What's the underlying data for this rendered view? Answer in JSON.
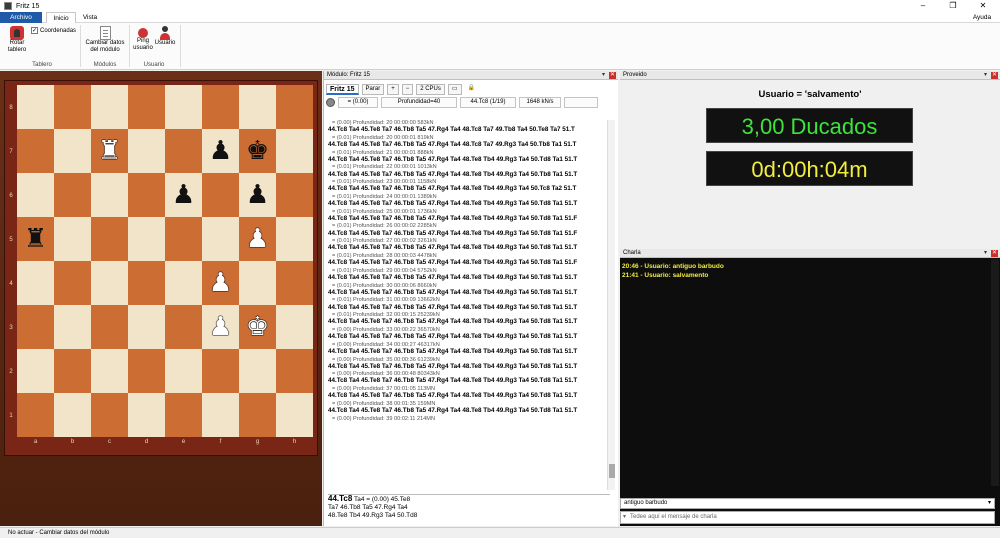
{
  "window": {
    "title": "Fritz 15",
    "minimize": "–",
    "maximize": "❐",
    "close": "✕"
  },
  "ribbon_tabs": {
    "archivo": "Archivo",
    "inicio": "Inicio",
    "vista": "Vista",
    "ayuda": "Ayuda"
  },
  "ribbon": {
    "rotar": "Rotar tablero",
    "coordenadas": "Coordenadas",
    "coordenadas_checked": "✓",
    "tablero_group": "Tablero",
    "cambiar_modulo": "Cambiar datos del módulo",
    "modulos_group": "Módulos",
    "ping": "Ping usuario",
    "usuario": "Usuario",
    "usuario_group": "Usuario"
  },
  "board": {
    "ranks": [
      "8",
      "7",
      "6",
      "5",
      "4",
      "3",
      "2",
      "1"
    ],
    "files": [
      "a",
      "b",
      "c",
      "d",
      "e",
      "f",
      "g",
      "h"
    ],
    "pieces": [
      {
        "square": "c7",
        "piece": "♜",
        "color": "white"
      },
      {
        "square": "f7",
        "piece": "♟",
        "color": "black"
      },
      {
        "square": "g7",
        "piece": "♚",
        "color": "black"
      },
      {
        "square": "e6",
        "piece": "♟",
        "color": "black"
      },
      {
        "square": "g6",
        "piece": "♟",
        "color": "black"
      },
      {
        "square": "a5",
        "piece": "♜",
        "color": "black"
      },
      {
        "square": "g5",
        "piece": "♟",
        "color": "white"
      },
      {
        "square": "f4",
        "piece": "♟",
        "color": "white"
      },
      {
        "square": "f3",
        "piece": "♟",
        "color": "white"
      },
      {
        "square": "g3",
        "piece": "♚",
        "color": "white"
      }
    ]
  },
  "engine": {
    "pane_title": "Módulo: Fritz 15",
    "engine_name": "Fritz 15",
    "stop": "Parar",
    "plus": "+",
    "minus": "−",
    "cpus": "2 CPUs",
    "eval": "= (0.00)",
    "depth": "Profundidad=40",
    "current_move": "44.Tc8 (1/19)",
    "speed": "1648 kN/s",
    "rows": [
      {
        "info": "= (0.00)   Profundidad: 20   00:00:00  583kN",
        "line": "44.Tc8 Ta4 45.Te8 Ta7 46.Tb8 Ta5 47.Rg4 Ta4 48.Tc8 Ta7 49.Tb8 Ta4 50.Te8 Ta7 51.T"
      },
      {
        "info": "= (0.01)   Profundidad: 20   00:00:01  819kN",
        "line": "44.Tc8 Ta4 45.Te8 Ta7 46.Tb8 Ta5 47.Rg4 Ta4 48.Tc8 Ta7 49.Rg3 Ta4 50.Tb8 Ta1 51.T"
      },
      {
        "info": "= (0.01)   Profundidad: 21   00:00:01  888kN",
        "line": "44.Tc8 Ta4 45.Te8 Ta7 46.Tb8 Ta5 47.Rg4 Ta4 48.Te8 Tb4 49.Rg3 Ta4 50.Td8 Ta1 51.T"
      },
      {
        "info": "= (0.01)   Profundidad: 22   00:00:01  1013kN",
        "line": "44.Tc8 Ta4 45.Te8 Ta7 46.Tb8 Ta5 47.Rg4 Ta4 48.Te8 Tb4 49.Rg3 Ta4 50.Tb8 Ta1 51.T"
      },
      {
        "info": "= (0.01)   Profundidad: 23   00:00:01  1158kN",
        "line": "44.Tc8 Ta4 45.Te8 Ta7 46.Tb8 Ta5 47.Rg4 Ta4 48.Te8 Tb4 49.Rg3 Ta4 50.Tc8 Ta2 51.T"
      },
      {
        "info": "= (0.01)   Profundidad: 24   00:00:01  1389kN",
        "line": "44.Tc8 Ta4 45.Te8 Ta7 46.Tb8 Ta5 47.Rg4 Ta4 48.Te8 Tb4 49.Rg3 Ta4 50.Td8 Ta1 51.T"
      },
      {
        "info": "= (0.01)   Profundidad: 25   00:00:01  1736kN",
        "line": "44.Tc8 Ta4 45.Te8 Ta7 46.Tb8 Ta5 47.Rg4 Ta4 48.Te8 Tb4 49.Rg3 Ta4 50.Td8 Ta1 51.F"
      },
      {
        "info": "= (0.01)   Profundidad: 26   00:00:02  2285kN",
        "line": "44.Tc8 Ta4 45.Te8 Ta7 46.Tb8 Ta5 47.Rg4 Ta4 48.Te8 Tb4 49.Rg3 Ta4 50.Td8 Ta1 51.F"
      },
      {
        "info": "= (0.01)   Profundidad: 27   00:00:02  3261kN",
        "line": "44.Tc8 Ta4 45.Te8 Ta7 46.Tb8 Ta5 47.Rg4 Ta4 48.Te8 Tb4 49.Rg3 Ta4 50.Td8 Ta1 51.T"
      },
      {
        "info": "= (0.01)   Profundidad: 28   00:00:03  4478kN",
        "line": "44.Tc8 Ta4 45.Te8 Ta7 46.Tb8 Ta5 47.Rg4 Ta4 48.Te8 Tb4 49.Rg3 Ta4 50.Td8 Ta1 51.F"
      },
      {
        "info": "= (0.01)   Profundidad: 29   00:00:04  5752kN",
        "line": "44.Tc8 Ta4 45.Te8 Ta7 46.Tb8 Ta5 47.Rg4 Ta4 48.Te8 Tb4 49.Rg3 Ta4 50.Td8 Ta1 51.T"
      },
      {
        "info": "= (0.01)   Profundidad: 30   00:00:06  8660kN",
        "line": "44.Tc8 Ta4 45.Te8 Ta7 46.Tb8 Ta5 47.Rg4 Ta4 48.Te8 Tb4 49.Rg3 Ta4 50.Td8 Ta1 51.T"
      },
      {
        "info": "= (0.01)   Profundidad: 31   00:00:09  13662kN",
        "line": "44.Tc8 Ta4 45.Te8 Ta7 46.Tb8 Ta5 47.Rg4 Ta4 48.Te8 Tb4 49.Rg3 Ta4 50.Td8 Ta1 51.T"
      },
      {
        "info": "= (0.01)   Profundidad: 32   00:00:15  25239kN",
        "line": "44.Tc8 Ta4 45.Te8 Ta7 46.Tb8 Ta5 47.Rg4 Ta4 48.Te8 Tb4 49.Rg3 Ta4 50.Td8 Ta1 51.T"
      },
      {
        "info": "= (0.00)   Profundidad: 33   00:00:22  36570kN",
        "line": "44.Tc8 Ta4 45.Te8 Ta7 46.Tb8 Ta5 47.Rg4 Ta4 48.Te8 Tb4 49.Rg3 Ta4 50.Td8 Ta1 51.T"
      },
      {
        "info": "= (0.00)   Profundidad: 34   00:00:27  46317kN",
        "line": "44.Tc8 Ta4 45.Te8 Ta7 46.Tb8 Ta5 47.Rg4 Ta4 48.Te8 Tb4 49.Rg3 Ta4 50.Td8 Ta1 51.T"
      },
      {
        "info": "= (0.00)   Profundidad: 35   00:00:36  61239kN",
        "line": "44.Tc8 Ta4 45.Te8 Ta7 46.Tb8 Ta5 47.Rg4 Ta4 48.Te8 Tb4 49.Rg3 Ta4 50.Td8 Ta1 51.T"
      },
      {
        "info": "= (0.00)   Profundidad: 36   00:00:48  80343kN",
        "line": "44.Tc8 Ta4 45.Te8 Ta7 46.Tb8 Ta5 47.Rg4 Ta4 48.Te8 Tb4 49.Rg3 Ta4 50.Td8 Ta1 51.T"
      },
      {
        "info": "= (0.00)   Profundidad: 37   00:01:05  113MN",
        "line": "44.Tc8 Ta4 45.Te8 Ta7 46.Tb8 Ta5 47.Rg4 Ta4 48.Te8 Tb4 49.Rg3 Ta4 50.Td8 Ta1 51.T"
      },
      {
        "info": "= (0.00)   Profundidad: 38   00:01:35  159MN",
        "line": "44.Tc8 Ta4 45.Te8 Ta7 46.Tb8 Ta5 47.Rg4 Ta4 48.Te8 Tb4 49.Rg3 Ta4 50.Td8 Ta1 51.T"
      },
      {
        "info": "= (0.00)   Profundidad: 39   00:02:11  214MN",
        "line": ""
      }
    ],
    "notation_move": "44.Tc8",
    "notation_rest": " Ta4 = (0.00)  45.Te8",
    "notation_line2": "Ta7  46.Tb8  Ta5  47.Rg4  Ta4",
    "notation_line3": "48.Te8  Tb4  49.Rg3  Ta4  50.Td8"
  },
  "proveido": {
    "pane_title": "Proveido",
    "user_caption": "Usuario = 'salvamento'",
    "ducados": "3,00 Ducados",
    "time": "0d:00h:04m"
  },
  "chat": {
    "pane_title": "Charla",
    "messages": [
      "20:46 - Usuario: antiguo barbudo",
      "21:41 - Usuario: salvamento"
    ],
    "selected_user": "antiguo barbudo",
    "input_placeholder": "Tedee aquí el mensaje de charla"
  },
  "status": {
    "text": "No actuar - Cambiar datos del módulo"
  }
}
